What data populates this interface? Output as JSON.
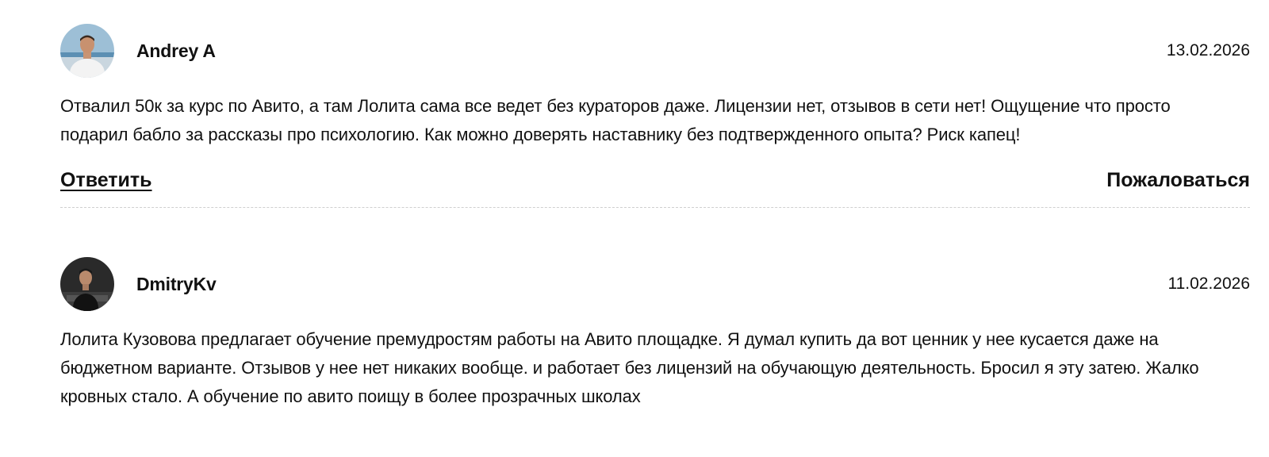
{
  "reviews": [
    {
      "author": "Andrey A",
      "date": "13.02.2026",
      "avatar_icon": "user-photo-avatar",
      "text": "Отвалил 50к за курс по Авито, а там Лолита сама все ведет без кураторов даже. Лицензии нет, отзывов в сети нет! Ощущение что просто подарил бабло за рассказы про психологию. Как можно доверять наставнику без подтвержденного опыта? Риск капец!",
      "reply_label": "Ответить",
      "report_label": "Пожаловаться"
    },
    {
      "author": "DmitryKv",
      "date": "11.02.2026",
      "avatar_icon": "user-photo-avatar",
      "text": "Лолита Кузовова предлагает обучение премудростям работы на Авито площадке. Я думал купить да вот ценник у нее кусается даже на бюджетном варианте. Отзывов у нее нет никаких вообще. и работает без лицензий на обучающую деятельность. Бросил я эту затею. Жалко кровных стало. А обучение по авито поищу в более прозрачных школах"
    }
  ]
}
